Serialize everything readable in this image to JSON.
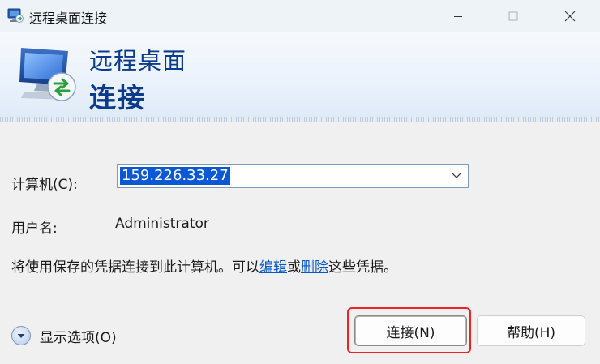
{
  "window": {
    "title": "远程桌面连接",
    "controls": [
      "minimize",
      "maximize",
      "close"
    ]
  },
  "header": {
    "line1": "远程桌面",
    "line2": "连接"
  },
  "form": {
    "computer_label": "计算机(C):",
    "computer_value": "159.226.33.27",
    "username_label": "用户名:",
    "username_value": "Administrator",
    "info_prefix": "将使用保存的凭据连接到此计算机。可以",
    "info_edit_link": "编辑",
    "info_or": "或",
    "info_delete_link": "删除",
    "info_suffix": "这些凭据。"
  },
  "options": {
    "toggle_label": "显示选项(O)"
  },
  "buttons": {
    "connect": "连接(N)",
    "help": "帮助(H)"
  },
  "annotation": {
    "highlight_color": "#ee2222",
    "highlighted_element": "connect-button"
  },
  "colors": {
    "header_text": "#0c3a8c",
    "selection": "#0a58d6",
    "link": "#0a58c8"
  }
}
